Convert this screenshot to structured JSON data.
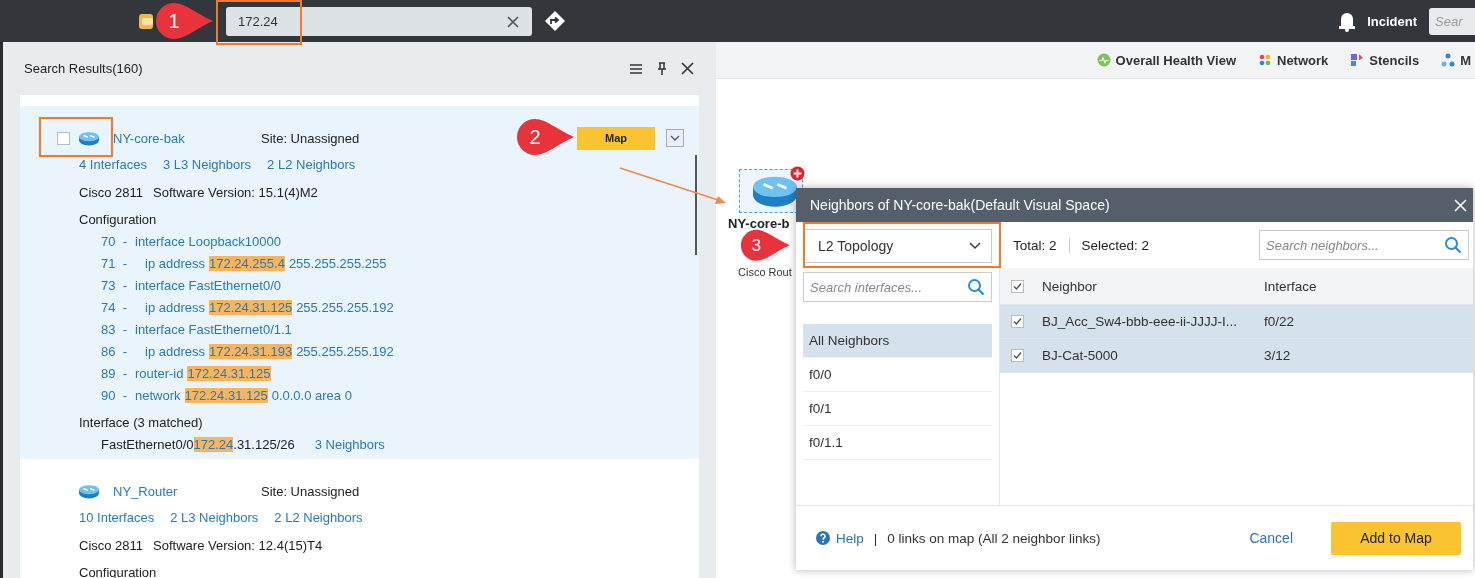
{
  "top_bar": {
    "search": {
      "value": "172.24"
    },
    "incident": "Incident",
    "right_search": {
      "placeholder": "Sear"
    }
  },
  "search_results": {
    "title": "Search Results(160)",
    "results": [
      {
        "name": "NY-core-bak",
        "site": "Site: Unassigned",
        "selected": true,
        "checked": false,
        "map_button": "Map",
        "links": [
          "4 Interfaces",
          "3 L3 Neighbors",
          "2 L2 Neighbors"
        ],
        "model": "Cisco  2811",
        "software": "Software Version: 15.1(4)M2",
        "config_title": "Configuration",
        "config_lines": [
          {
            "number": "70  -",
            "parts": [
              {
                "text": "interface Loopback10000",
                "highlight": false
              }
            ],
            "children": [
              {
                "number": "71  -",
                "parts": [
                  {
                    "text": "ip address",
                    "highlight": false
                  },
                  {
                    "text": "172.24.255.4",
                    "highlight": true
                  },
                  {
                    "text": "255.255.255.255",
                    "highlight": false
                  }
                ]
              }
            ]
          },
          {
            "number": "73  -",
            "parts": [
              {
                "text": "interface FastEthernet0/0",
                "highlight": false
              }
            ],
            "children": [
              {
                "number": "74  -",
                "parts": [
                  {
                    "text": "ip address",
                    "highlight": false
                  },
                  {
                    "text": "172.24.31.125",
                    "highlight": true
                  },
                  {
                    "text": "255.255.255.192",
                    "highlight": false
                  }
                ]
              }
            ]
          },
          {
            "number": "83  -",
            "parts": [
              {
                "text": "interface FastEthernet0/1.1",
                "highlight": false
              }
            ],
            "children": [
              {
                "number": "86  -",
                "parts": [
                  {
                    "text": "ip address",
                    "highlight": false
                  },
                  {
                    "text": "172.24.31.193",
                    "highlight": true
                  },
                  {
                    "text": "255.255.255.192",
                    "highlight": false
                  }
                ]
              }
            ]
          },
          {
            "number": "89  -",
            "parts": [
              {
                "text": "router-id",
                "highlight": false
              },
              {
                "text": "172.24.31.125",
                "highlight": true
              }
            ]
          },
          {
            "number": "90  -",
            "parts": [
              {
                "text": "network",
                "highlight": false
              },
              {
                "text": "172.24.31.125",
                "highlight": true
              },
              {
                "text": "0.0.0.0 area 0",
                "highlight": false
              }
            ]
          }
        ],
        "interface_title": "Interface (3 matched)",
        "interfaces": [
          {
            "parts": [
              {
                "text": "FastEthernet0/0 ",
                "highlight": false
              },
              {
                "text": "172.24",
                "highlight": true
              },
              {
                "text": ".31.125/26",
                "highlight": false
              }
            ],
            "neighbors": "3 Neighbors"
          }
        ]
      },
      {
        "name": "NY_Router",
        "site": "Site: Unassigned",
        "selected": false,
        "links": [
          "10 Interfaces",
          "2 L3 Neighbors",
          "2 L2 Neighbors"
        ],
        "model": "Cisco  2811",
        "software": "Software Version: 12.4(15)T4",
        "config_title": "Configuration"
      }
    ]
  },
  "toolbar": [
    {
      "label": "Overall Health View",
      "kind": "health"
    },
    {
      "label": "Network",
      "kind": "network"
    },
    {
      "label": "Stencils",
      "kind": "stencils"
    },
    {
      "label": "M",
      "kind": "map"
    }
  ],
  "map_node": {
    "label": "NY-core-b",
    "sublabel": "Cisco Rout",
    "selected": true
  },
  "dialog": {
    "title": "Neighbors of NY-core-bak(Default Visual Space)",
    "dropdown": {
      "value": "L2 Topology"
    },
    "interface_search": {
      "placeholder": "Search interfaces..."
    },
    "interfaces": [
      {
        "label": "All Neighbors",
        "selected": true
      },
      {
        "label": "f0/0",
        "selected": false
      },
      {
        "label": "f0/1",
        "selected": false
      },
      {
        "label": "f0/1.1",
        "selected": false
      }
    ],
    "total": "Total: 2",
    "selected_count": "Selected: 2",
    "neighbor_search": {
      "placeholder": "Search neighbors..."
    },
    "table": {
      "header_checked": true,
      "columns": [
        "Neighbor",
        "Interface"
      ],
      "rows": [
        {
          "cells": [
            "BJ_Acc_Sw4-bbb-eee-ii-JJJJ-I...",
            "f0/22"
          ],
          "checked": true,
          "selected": true
        },
        {
          "cells": [
            "BJ-Cat-5000",
            "3/12"
          ],
          "checked": true,
          "selected": true
        }
      ]
    },
    "footer": {
      "help": "Help",
      "separator": "|",
      "links_info": "0 links on map (All 2 neighbor links)",
      "cancel": "Cancel",
      "add": "Add to Map"
    }
  },
  "annotations": [
    {
      "number": "1"
    },
    {
      "number": "2"
    },
    {
      "number": "3"
    }
  ]
}
